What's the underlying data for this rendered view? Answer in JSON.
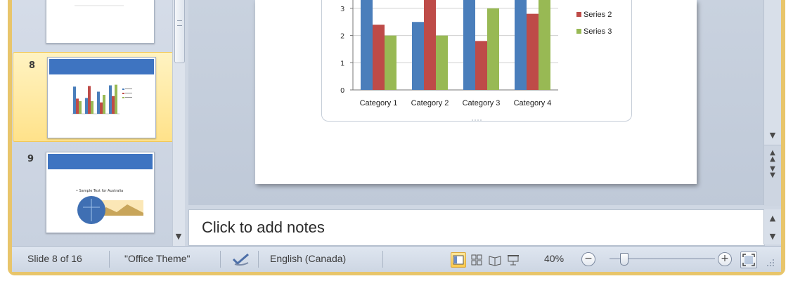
{
  "thumbnails": {
    "items": [
      {
        "number": ""
      },
      {
        "number": "8"
      },
      {
        "number": "9",
        "title_text": "• Sample Text for Australia"
      }
    ]
  },
  "main_chart": {
    "legend": [
      "Series 2",
      "Series 3"
    ],
    "y_ticks": [
      "0",
      "1",
      "2",
      "3"
    ],
    "categories": [
      "Category 1",
      "Category 2",
      "Category 3",
      "Category 4"
    ]
  },
  "chart_data": {
    "type": "bar",
    "categories": [
      "Category 1",
      "Category 2",
      "Category 3",
      "Category 4"
    ],
    "series": [
      {
        "name": "",
        "values": [
          4.3,
          2.5,
          3.5,
          4.5
        ],
        "color": "#4a7ebb"
      },
      {
        "name": "Series 2",
        "values": [
          2.4,
          4.4,
          1.8,
          2.8
        ],
        "color": "#be4b48"
      },
      {
        "name": "Series 3",
        "values": [
          2.0,
          2.0,
          3.0,
          5.0
        ],
        "color": "#98b954"
      }
    ],
    "ylim": [
      0,
      3.1
    ],
    "legend_position": "right"
  },
  "notes": {
    "placeholder": "Click to add notes"
  },
  "status_bar": {
    "slide_position": "Slide 8 of 16",
    "theme": "\"Office Theme\"",
    "language": "English (Canada)",
    "zoom": "40%",
    "zoom_level_percent": 40,
    "zoom_out_symbol": "−",
    "zoom_in_symbol": "+"
  },
  "colors": {
    "frame": "#e8c56b",
    "title_bar": "#3e74c1",
    "selected": "#ffe28a"
  }
}
